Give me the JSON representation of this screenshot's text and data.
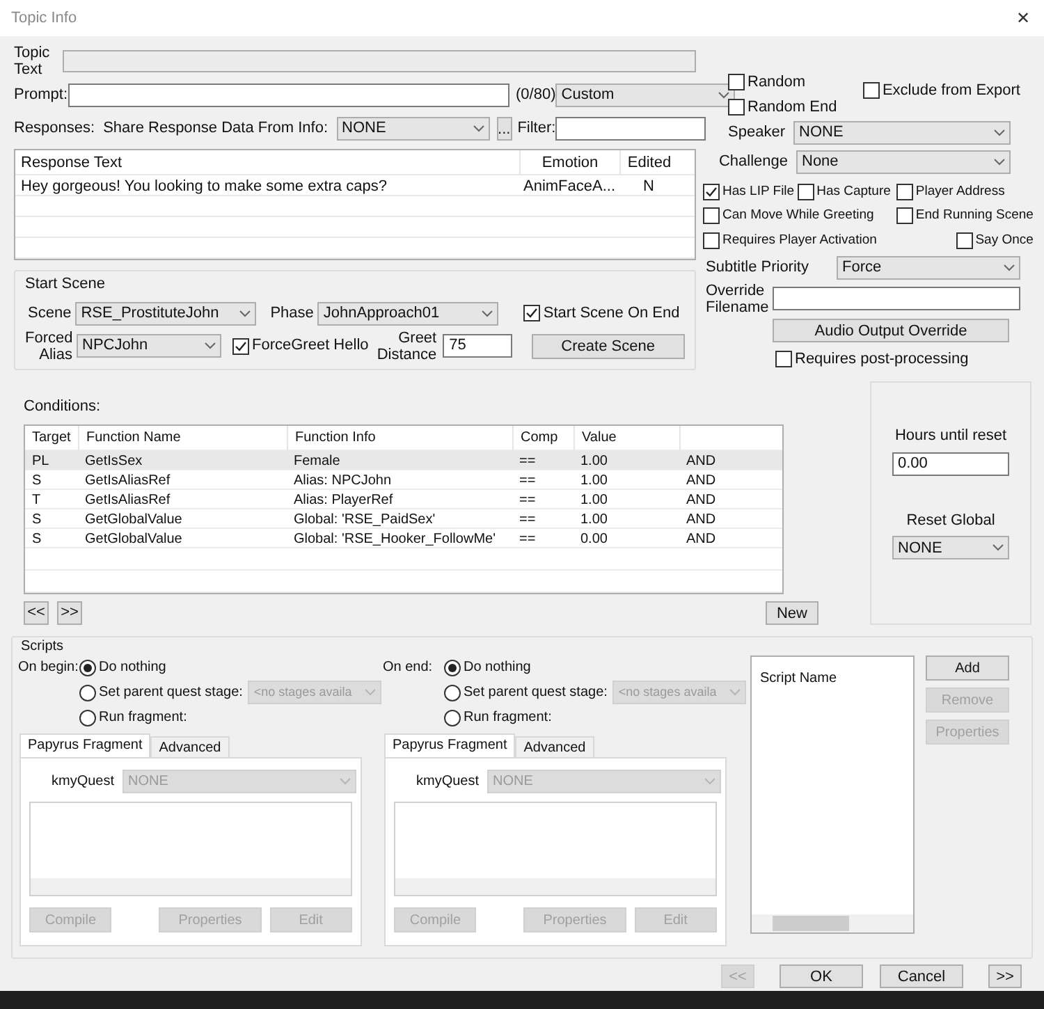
{
  "window": {
    "title": "Topic Info",
    "close": "✕"
  },
  "topic_text": {
    "label": "Topic Text"
  },
  "prompt": {
    "label": "Prompt:",
    "counter": "(0/80)",
    "type": "Custom"
  },
  "responses": {
    "label": "Responses:",
    "share_label": "Share Response Data From Info:",
    "share_value": "NONE",
    "browse": "...",
    "filter_label": "Filter:"
  },
  "response_table": {
    "columns": [
      "Response Text",
      "Emotion",
      "Edited"
    ],
    "rows": [
      [
        "Hey gorgeous! You looking to make some extra caps?",
        "AnimFaceA...",
        "N"
      ]
    ]
  },
  "start_scene": {
    "title": "Start Scene",
    "scene_label": "Scene",
    "scene": "RSE_ProstituteJohn",
    "phase_label": "Phase",
    "phase": "JohnApproach01",
    "start_on_end": {
      "label": "Start Scene On End",
      "checked": true
    },
    "alias_label": "Forced Alias",
    "alias": "NPCJohn",
    "force_greet": {
      "label": "ForceGreet Hello",
      "checked": true
    },
    "greet_label": "Greet Distance",
    "greet_distance": "75",
    "create_button": "Create Scene"
  },
  "top_flags": [
    {
      "label": "Random",
      "checked": false
    },
    {
      "label": "Random End",
      "checked": false
    },
    {
      "label": "Exclude from Export",
      "checked": false
    }
  ],
  "speaker": {
    "label": "Speaker",
    "value": "NONE"
  },
  "challenge": {
    "label": "Challenge",
    "value": "None"
  },
  "options": [
    {
      "label": "Has LIP File",
      "checked": true
    },
    {
      "label": "Has Capture",
      "checked": false
    },
    {
      "label": "Player Address",
      "checked": false
    },
    {
      "label": "Can Move While Greeting",
      "checked": false
    },
    {
      "label": "End Running Scene",
      "checked": false
    },
    {
      "label": "Requires Player Activation",
      "checked": false
    },
    {
      "label": "Say Once",
      "checked": false
    }
  ],
  "subtitle_priority": {
    "label": "Subtitle Priority",
    "value": "Force"
  },
  "override_filename": {
    "label": "Override Filename"
  },
  "audio_button": "Audio Output Override",
  "post_processing": {
    "label": "Requires post-processing",
    "checked": false
  },
  "conditions": {
    "label": "Conditions:",
    "columns": [
      "Target",
      "Function Name",
      "Function Info",
      "Comp",
      "Value"
    ],
    "rows": [
      {
        "cells": [
          "PL",
          "GetIsSex",
          "Female",
          "==",
          "1.00",
          "AND"
        ],
        "selected": true
      },
      {
        "cells": [
          "S",
          "GetIsAliasRef",
          "Alias: NPCJohn",
          "==",
          "1.00",
          "AND"
        ],
        "selected": false
      },
      {
        "cells": [
          "T",
          "GetIsAliasRef",
          "Alias: PlayerRef",
          "==",
          "1.00",
          "AND"
        ],
        "selected": false
      },
      {
        "cells": [
          "S",
          "GetGlobalValue",
          "Global: 'RSE_PaidSex'",
          "==",
          "1.00",
          "AND"
        ],
        "selected": false
      },
      {
        "cells": [
          "S",
          "GetGlobalValue",
          "Global: 'RSE_Hooker_FollowMe'",
          "==",
          "0.00",
          "AND"
        ],
        "selected": false
      }
    ],
    "prev": "<<",
    "next": ">>",
    "new": "New"
  },
  "reset": {
    "hours_label": "Hours until reset",
    "hours": "0.00",
    "global_label": "Reset Global",
    "global": "NONE"
  },
  "scripts": {
    "title": "Scripts",
    "blocks": [
      {
        "label": "On begin:",
        "options": [
          {
            "label": "Do nothing",
            "selected": true
          },
          {
            "label": "Set parent quest stage:",
            "selected": false
          },
          {
            "label": "Run fragment:",
            "selected": false
          }
        ],
        "stage": "<no stages availa",
        "tabs": [
          {
            "label": "Papyrus Fragment",
            "selected": true
          },
          {
            "label": "Advanced",
            "selected": false
          }
        ],
        "kmy_label": "kmyQuest",
        "kmy": "NONE",
        "buttons": [
          "Compile",
          "Properties",
          "Edit"
        ]
      },
      {
        "label": "On end:",
        "options": [
          {
            "label": "Do nothing",
            "selected": true
          },
          {
            "label": "Set parent quest stage:",
            "selected": false
          },
          {
            "label": "Run fragment:",
            "selected": false
          }
        ],
        "stage": "<no stages availa",
        "tabs": [
          {
            "label": "Papyrus Fragment",
            "selected": true
          },
          {
            "label": "Advanced",
            "selected": false
          }
        ],
        "kmy_label": "kmyQuest",
        "kmy": "NONE",
        "buttons": [
          "Compile",
          "Properties",
          "Edit"
        ]
      }
    ],
    "list_header": "Script Name",
    "list_buttons": [
      {
        "label": "Add",
        "disabled": false
      },
      {
        "label": "Remove",
        "disabled": true
      },
      {
        "label": "Properties",
        "disabled": true
      }
    ]
  },
  "footer": [
    {
      "label": "<<",
      "disabled": true
    },
    {
      "label": "OK",
      "disabled": false
    },
    {
      "label": "Cancel",
      "disabled": false
    },
    {
      "label": ">>",
      "disabled": false
    }
  ]
}
